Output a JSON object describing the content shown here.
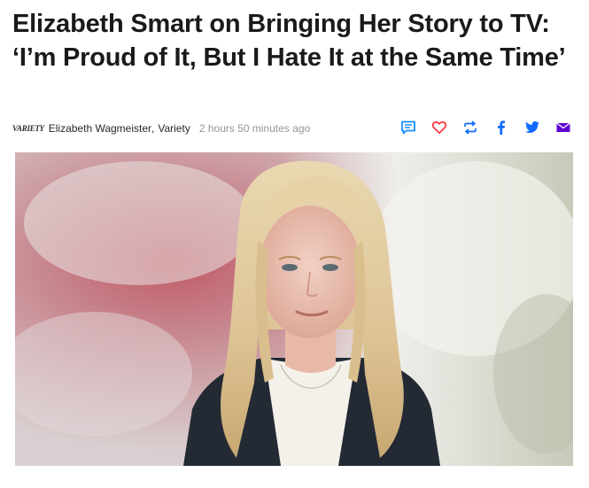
{
  "headline": "Elizabeth Smart on Bringing Her Story to TV: ‘I’m Proud of It, But I Hate It at the Same Time’",
  "byline": {
    "source_logo": "VARIETY",
    "author": "Elizabeth Wagmeister",
    "separator": ",",
    "provider": "Variety",
    "timestamp": "2 hours 50 minutes ago"
  },
  "actions": {
    "icons": [
      "comment-icon",
      "heart-icon",
      "retweet-icon",
      "facebook-icon",
      "twitter-icon",
      "mail-icon"
    ],
    "colors": {
      "comment": "#188fff",
      "heart": "#ff333a",
      "share": "#0f69ff",
      "mail": "#5f01d1"
    }
  },
  "hero_image": {
    "description": "Woman with long blonde hair wearing a dark blazer over a white blouse against a blurred pink and white background"
  }
}
